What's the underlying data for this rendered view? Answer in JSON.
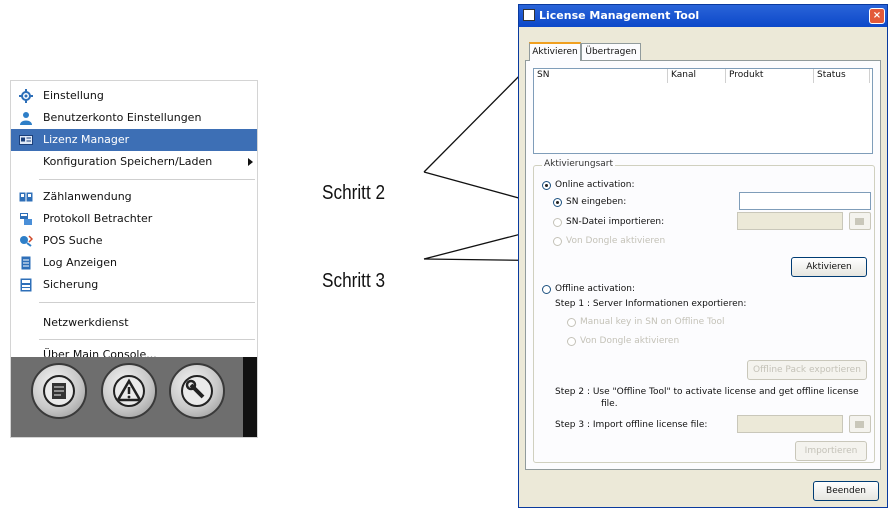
{
  "menu": {
    "items": [
      {
        "label": "Einstellung",
        "icon": "gear-icon"
      },
      {
        "label": "Benutzerkonto Einstellungen",
        "icon": "user-icon"
      },
      {
        "label": "Lizenz Manager",
        "icon": "license-icon",
        "selected": true
      },
      {
        "label": "Konfiguration Speichern/Laden",
        "icon": "",
        "submenu": true
      },
      {
        "label": "Zählanwendung",
        "icon": "counter-icon"
      },
      {
        "label": "Protokoll Betrachter",
        "icon": "log-viewer-icon"
      },
      {
        "label": "POS Suche",
        "icon": "search-icon"
      },
      {
        "label": "Log Anzeigen",
        "icon": "document-icon"
      },
      {
        "label": "Sicherung",
        "icon": "backup-icon"
      },
      {
        "label": "Netzwerkdienst",
        "icon": ""
      },
      {
        "label": "Über Main Console...",
        "icon": ""
      }
    ],
    "toolbar_icons": [
      "console-icon",
      "warning-icon",
      "wrench-icon"
    ]
  },
  "callouts": {
    "step2": "Schritt 2",
    "step3": "Schritt 3"
  },
  "dialog": {
    "title": "License Management Tool",
    "tabs": [
      "Aktivieren",
      "Übertragen"
    ],
    "columns": [
      "SN",
      "Kanal",
      "Produkt",
      "Status"
    ],
    "group_title": "Aktivierungsart",
    "online_activation": "Online activation:",
    "sn_input": "SN eingeben:",
    "sn_file": "SN-Datei importieren:",
    "von_dongle": "Von Dongle aktivieren",
    "aktivieren_button": "Aktivieren",
    "offline_activation": "Offline activation:",
    "step1": "Step 1 : Server Informationen exportieren:",
    "manual_key": "Manual key in SN on Offline Tool",
    "von_dongle_2": "Von Dongle aktivieren",
    "offline_pack_button": "Offline Pack exportieren",
    "step2_line1": "Step 2 : Use \"Offline Tool\" to activate license and get offline license",
    "step2_line2": "file.",
    "step3": "Step 3 : Import offline license file:",
    "importieren_button": "Importieren",
    "beenden_button": "Beenden"
  },
  "colors": {
    "menu_selected": "#3d6fb5",
    "titlebar": "#0c48c9",
    "dialog_bg": "#ece9d8"
  }
}
